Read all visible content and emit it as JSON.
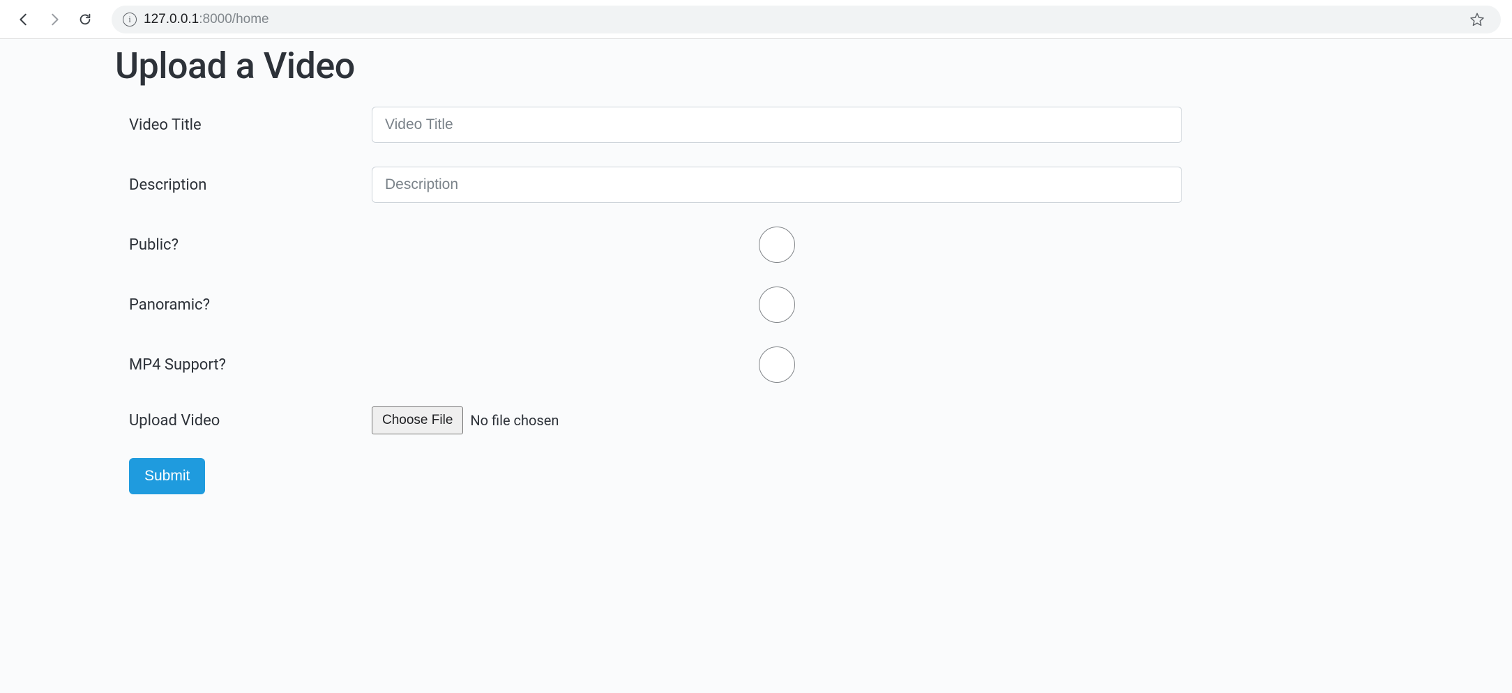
{
  "browser": {
    "url_host": "127.0.0.1",
    "url_port_path": ":8000/home"
  },
  "page": {
    "title": "Upload a Video"
  },
  "form": {
    "video_title": {
      "label": "Video Title",
      "placeholder": "Video Title",
      "value": ""
    },
    "description": {
      "label": "Description",
      "placeholder": "Description",
      "value": ""
    },
    "public": {
      "label": "Public?",
      "checked": false
    },
    "panoramic": {
      "label": "Panoramic?",
      "checked": false
    },
    "mp4_support": {
      "label": "MP4 Support?",
      "checked": false
    },
    "upload": {
      "label": "Upload Video",
      "button": "Choose File",
      "status": "No file chosen"
    },
    "submit_label": "Submit"
  }
}
